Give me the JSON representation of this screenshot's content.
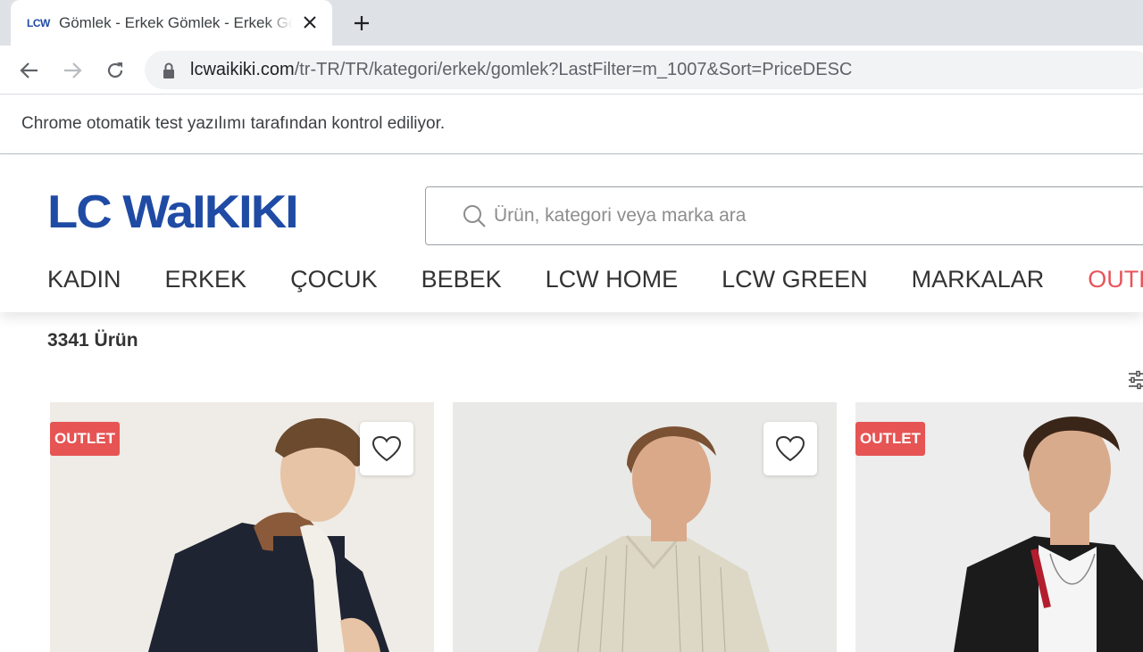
{
  "browser": {
    "tab": {
      "favicon_text": "LCW",
      "title": "Gömlek - Erkek Gömlek - Erkek Gömlek Modelleri"
    },
    "url": {
      "host": "lcwaikiki.com",
      "path": "/tr-TR/TR/kategori/erkek/gomlek?LastFilter=m_1007&Sort=PriceDESC"
    },
    "infobar_text": "Chrome otomatik test yazılımı tarafından kontrol ediliyor."
  },
  "site": {
    "logo_text": "LC WaIKIKI",
    "brand_color": "#1f4ba5",
    "accent_color": "#e8545a",
    "search": {
      "placeholder": "Ürün, kategori veya marka ara"
    },
    "nav": {
      "items": [
        {
          "label": "KADIN"
        },
        {
          "label": "ERKEK"
        },
        {
          "label": "ÇOCUK"
        },
        {
          "label": "BEBEK"
        },
        {
          "label": "LCW HOME"
        },
        {
          "label": "LCW GREEN"
        },
        {
          "label": "MARKALAR"
        },
        {
          "label": "OUTLET"
        }
      ]
    }
  },
  "listing": {
    "product_count": "3341 Ürün",
    "products": [
      {
        "badge": "OUTLET",
        "has_favorite": true
      },
      {
        "badge": "",
        "has_favorite": true
      },
      {
        "badge": "OUTLET",
        "has_favorite": false
      }
    ]
  },
  "icons": {
    "back": "arrow-left-icon",
    "forward": "arrow-right-icon",
    "reload": "reload-icon",
    "lock": "lock-icon",
    "search": "search-icon",
    "favorite": "heart-icon",
    "filter": "filter-sliders-icon",
    "new_tab": "plus-icon",
    "close": "close-icon"
  }
}
